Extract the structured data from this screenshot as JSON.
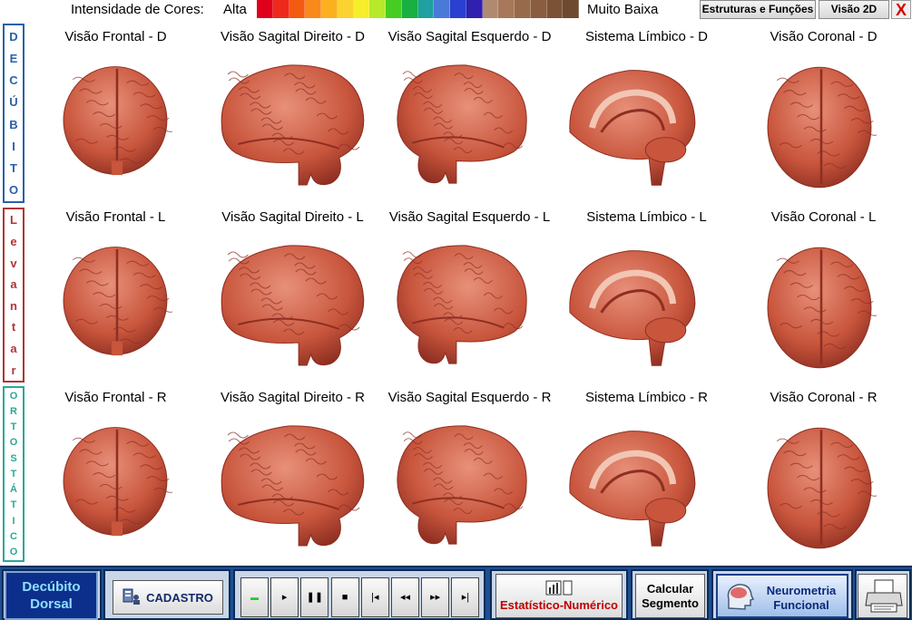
{
  "legend": {
    "title": "Intensidade de Cores:",
    "high_label": "Alta",
    "low_label": "Muito Baixa",
    "scale_colors": [
      "#e0001a",
      "#ee2a1a",
      "#f35a12",
      "#f8891a",
      "#fbb020",
      "#fbd230",
      "#f6ee2a",
      "#b8e82a",
      "#46cc22",
      "#18b040",
      "#20a0a0",
      "#4a7ad8",
      "#2a40d0",
      "#3020b0",
      "#b08a70",
      "#a8785a",
      "#986a4c",
      "#8a5c40",
      "#7c5236",
      "#6e4a30"
    ]
  },
  "top_buttons": {
    "estruturas": "Estruturas e Funções",
    "visao2d": "Visão 2D",
    "close": "X"
  },
  "side_labels": {
    "decubito": [
      "D",
      "E",
      "C",
      "Ú",
      "B",
      "I",
      "T",
      "O"
    ],
    "levantar": [
      "L",
      "e",
      "v",
      "a",
      "n",
      "t",
      "a",
      "r"
    ],
    "ortostatico": [
      "O",
      "R",
      "T",
      "O",
      "S",
      "T",
      "Á",
      "T",
      "I",
      "C",
      "O"
    ]
  },
  "rows": [
    {
      "titles": [
        "Visão Frontal - D",
        "Visão Sagital Direito - D",
        "Visão Sagital Esquerdo - D",
        "Sistema Límbico - D",
        "Visão Coronal - D"
      ]
    },
    {
      "titles": [
        "Visão Frontal - L",
        "Visão Sagital Direito - L",
        "Visão Sagital Esquerdo - L",
        "Sistema Límbico - L",
        "Visão Coronal - L"
      ]
    },
    {
      "titles": [
        "Visão Frontal - R",
        "Visão Sagital Direito - R",
        "Visão Sagital Esquerdo - R",
        "Sistema Límbico - R",
        "Visão Coronal - R"
      ]
    }
  ],
  "bottom": {
    "dorsal_line1": "Decúbito",
    "dorsal_line2": "Dorsal",
    "cadastro": "CADASTRO",
    "media_controls": [
      "record",
      "play",
      "pause",
      "stop",
      "first",
      "rewind",
      "forward",
      "last"
    ],
    "estatistico": "Estatístico-Numérico",
    "calcular_line1": "Calcular",
    "calcular_line2": "Segmento",
    "neuro_line1": "Neurometria",
    "neuro_line2": "Funcional",
    "print_icon": "printer-icon"
  }
}
